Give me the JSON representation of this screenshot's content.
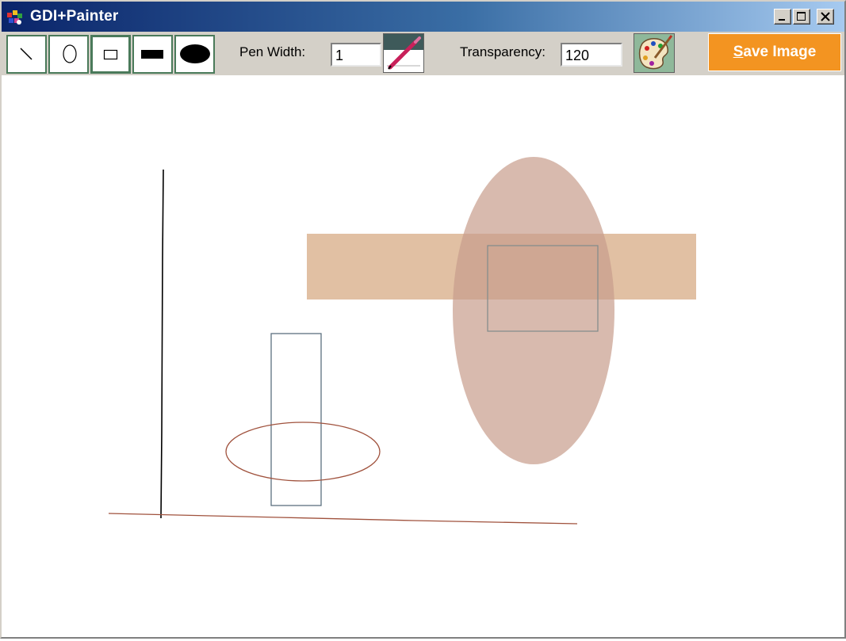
{
  "window": {
    "title": "GDI+Painter",
    "controls": [
      "minimize-icon",
      "maximize-icon",
      "close-icon"
    ]
  },
  "toolbar": {
    "tools": [
      {
        "name": "line-tool",
        "icon": "line-icon"
      },
      {
        "name": "ellipse-tool",
        "icon": "ellipse-outline-icon"
      },
      {
        "name": "rectangle-tool",
        "icon": "rectangle-outline-icon"
      },
      {
        "name": "filled-rectangle-tool",
        "icon": "filled-rectangle-icon"
      },
      {
        "name": "filled-ellipse-tool",
        "icon": "filled-ellipse-icon"
      }
    ],
    "pen_width_label": "Pen Width:",
    "pen_width_value": "1",
    "pen_color_icon": "pen-icon",
    "transparency_label": "Transparency:",
    "transparency_value": "120",
    "palette_icon": "palette-icon",
    "save_label_first": "S",
    "save_label_rest": "ave Image",
    "save_color": "#f39421"
  },
  "canvas": {
    "background": "#ffffff",
    "shape_colors": {
      "brown_line": "#a0523d",
      "black_line": "#000000",
      "slate_rect": "#5c7080",
      "tan_fill": "#d9b08c",
      "mauve_fill": "#c89c8c"
    }
  }
}
